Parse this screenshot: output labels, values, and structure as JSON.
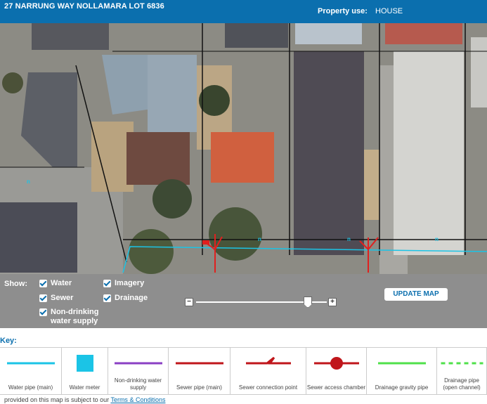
{
  "header": {
    "address": "27 NARRUNG WAY NOLLAMARA LOT 6836",
    "property_use_label": "Property use:",
    "property_use_value": "HOUSE"
  },
  "map": {
    "marker_glyph": "n"
  },
  "controls": {
    "show_label": "Show:",
    "checkboxes": [
      {
        "label": "Water",
        "checked": true
      },
      {
        "label": "Sewer",
        "checked": true
      },
      {
        "label": "Non-drinking water supply",
        "checked": true
      },
      {
        "label": "Imagery",
        "checked": true
      },
      {
        "label": "Drainage",
        "checked": true
      }
    ],
    "zoom_level": 0.85,
    "update_label": "UPDATE MAP"
  },
  "key": {
    "label": "Key:",
    "items": [
      {
        "label": "Water pipe (main)",
        "icon": "water-pipe-line",
        "color": "#1bc4e6"
      },
      {
        "label": "Water meter",
        "icon": "water-meter-square",
        "color": "#1bc4e6"
      },
      {
        "label": "Non-drinking water supply",
        "icon": "non-drinking-line",
        "color": "#8a3fc4"
      },
      {
        "label": "Sewer pipe (main)",
        "icon": "sewer-pipe-line",
        "color": "#c0161b"
      },
      {
        "label": "Sewer connection point",
        "icon": "sewer-connection-symbol",
        "color": "#c0161b"
      },
      {
        "label": "Sewer access chamber",
        "icon": "sewer-access-chamber-symbol",
        "color": "#c0161b"
      },
      {
        "label": "Drainage gravity pipe",
        "icon": "drainage-gravity-line",
        "color": "#4fe04a"
      },
      {
        "label": "Drainage pipe (open channel)",
        "icon": "drainage-open-channel-line",
        "color": "#4fe04a"
      }
    ]
  },
  "footer": {
    "text": "provided on this map is subject to our",
    "link": "Terms & Conditions"
  }
}
